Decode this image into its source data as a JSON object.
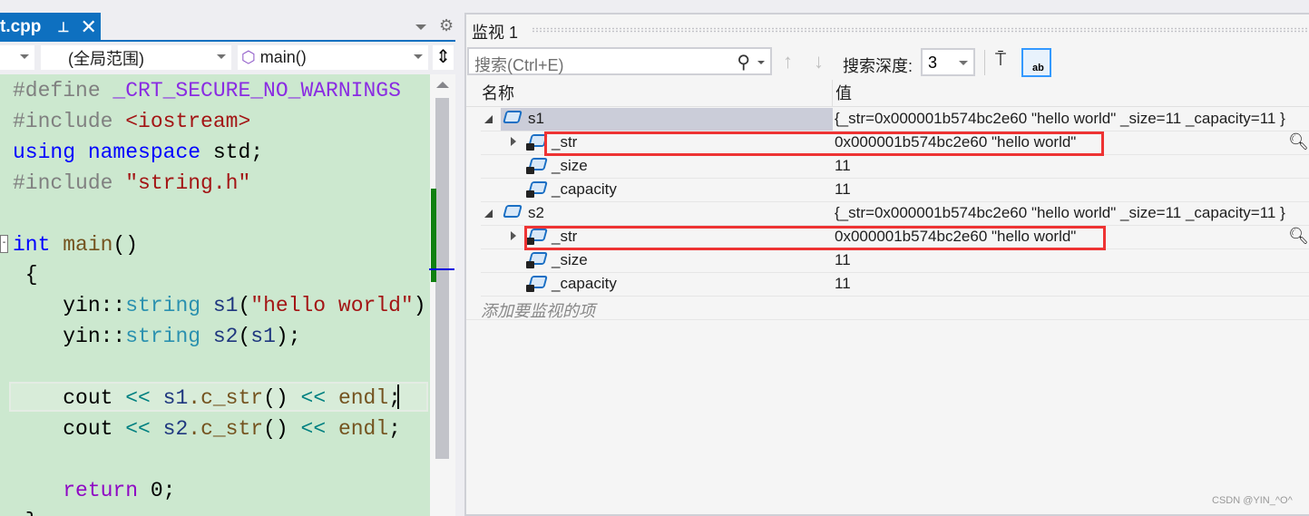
{
  "tab": {
    "title": "t.cpp",
    "pin": "⊥",
    "close": "✕"
  },
  "nav": {
    "scope": "(全局范围)",
    "function": "main()"
  },
  "code": [
    [
      [
        "#define ",
        "pp"
      ],
      [
        "_CRT_SECURE_NO_WARNINGS",
        "mac"
      ]
    ],
    [
      [
        "#include ",
        "pp"
      ],
      [
        "<iostream>",
        "str"
      ]
    ],
    [
      [
        "using ",
        "kw"
      ],
      [
        "namespace ",
        "kw"
      ],
      [
        "std;",
        "pl"
      ]
    ],
    [
      [
        "#include ",
        "pp"
      ],
      [
        "\"string.h\"",
        "str"
      ]
    ],
    [],
    [
      [
        "int ",
        "kw"
      ],
      [
        "main",
        "fn"
      ],
      [
        "()",
        "pl"
      ]
    ],
    [
      [
        " {",
        "pl"
      ]
    ],
    [
      [
        "    yin::",
        "pl"
      ],
      [
        "string ",
        "typ"
      ],
      [
        "s1",
        "var"
      ],
      [
        "(",
        "pl"
      ],
      [
        "\"hello world\"",
        "str"
      ],
      [
        ")",
        "pl"
      ]
    ],
    [
      [
        "    yin::",
        "pl"
      ],
      [
        "string ",
        "typ"
      ],
      [
        "s2",
        "var"
      ],
      [
        "(",
        "pl"
      ],
      [
        "s1",
        "var"
      ],
      [
        ");",
        "pl"
      ]
    ],
    [],
    [
      [
        "    cout ",
        "pl"
      ],
      [
        "<< ",
        "op"
      ],
      [
        "s1",
        "var"
      ],
      [
        ".c_str",
        "fn"
      ],
      [
        "() ",
        "pl"
      ],
      [
        "<< ",
        "op"
      ],
      [
        "endl",
        "fn"
      ],
      [
        ";",
        "pl"
      ]
    ],
    [
      [
        "    cout ",
        "pl"
      ],
      [
        "<< ",
        "op"
      ],
      [
        "s2",
        "var"
      ],
      [
        ".c_str",
        "fn"
      ],
      [
        "() ",
        "pl"
      ],
      [
        "<< ",
        "op"
      ],
      [
        "endl",
        "fn"
      ],
      [
        ";",
        "pl"
      ]
    ],
    [],
    [
      [
        "    return ",
        "ret"
      ],
      [
        "0;",
        "pl"
      ]
    ],
    [
      [
        " }",
        "pl"
      ]
    ]
  ],
  "watch": {
    "title": "监视 1",
    "search_placeholder": "搜索(Ctrl+E)",
    "depth_label": "搜索深度:",
    "depth_value": "3",
    "col_name": "名称",
    "col_value": "值",
    "rows": [
      {
        "name": "s1",
        "value": "{_str=0x000001b574bc2e60 \"hello world\" _size=11 _capacity=11 }"
      },
      {
        "name": "_str",
        "value": "0x000001b574bc2e60 \"hello world\""
      },
      {
        "name": "_size",
        "value": "11"
      },
      {
        "name": "_capacity",
        "value": "11"
      },
      {
        "name": "s2",
        "value": "{_str=0x000001b574bc2e60 \"hello world\" _size=11 _capacity=11 }"
      },
      {
        "name": "_str",
        "value": "0x000001b574bc2e60 \"hello world\""
      },
      {
        "name": "_size",
        "value": "11"
      },
      {
        "name": "_capacity",
        "value": "11"
      }
    ],
    "add_item": "添加要监视的项"
  },
  "watermark": "CSDN @YIN_^O^"
}
